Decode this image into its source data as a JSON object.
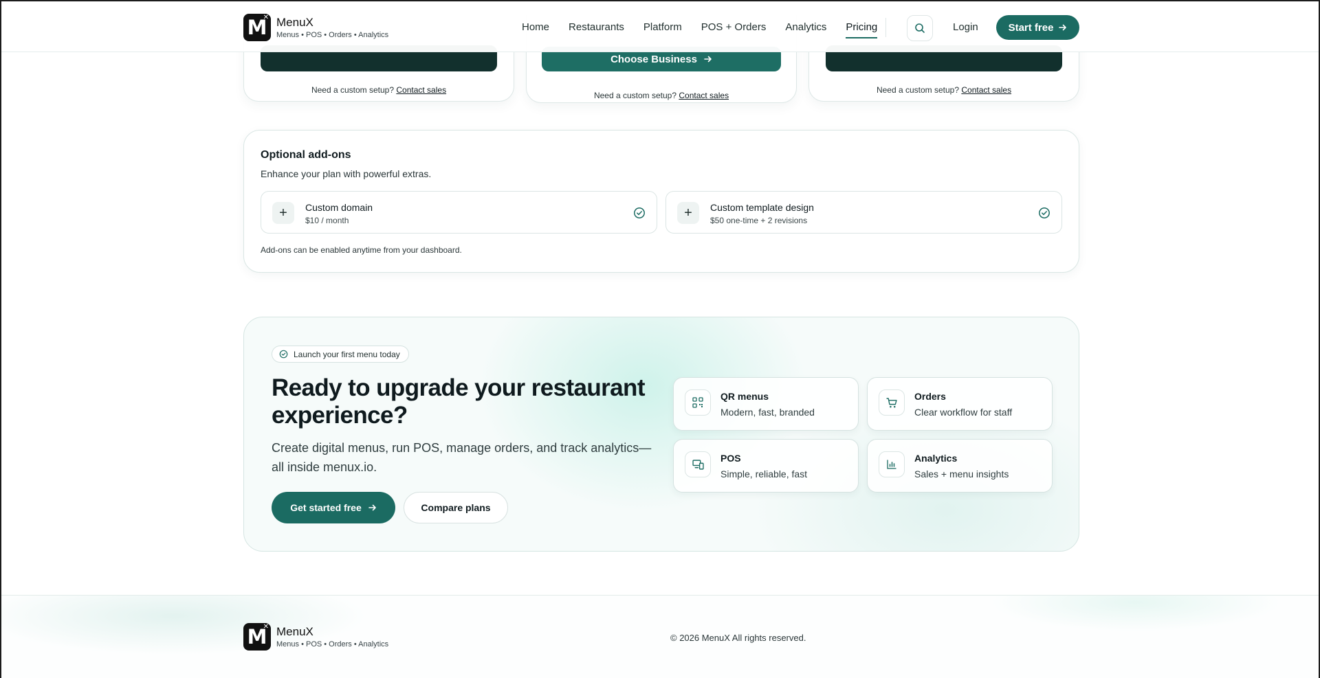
{
  "brand": {
    "name": "MenuX",
    "logo_letter": "M",
    "tagline": "Menus • POS • Orders • Analytics"
  },
  "nav": {
    "items": [
      "Home",
      "Restaurants",
      "Platform",
      "POS + Orders",
      "Analytics",
      "Pricing"
    ],
    "active": "Pricing",
    "login": "Login",
    "start": "Start free"
  },
  "pricing": {
    "middle_button": "Choose Business",
    "custom_text": "Need a custom setup?",
    "contact_link": "Contact sales"
  },
  "addons": {
    "title": "Optional add-ons",
    "subtitle": "Enhance your plan with powerful extras.",
    "items": [
      {
        "name": "Custom domain",
        "price": "$10 / month"
      },
      {
        "name": "Custom template design",
        "price": "$50 one-time + 2 revisions"
      }
    ],
    "note": "Add-ons can be enabled anytime from your dashboard."
  },
  "cta": {
    "pill": "Launch your first menu today",
    "headline": "Ready to upgrade your restaurant experience?",
    "lead": "Create digital menus, run POS, manage orders, and track analytics—all inside menux.io.",
    "primary": "Get started free",
    "secondary": "Compare plans",
    "features": [
      {
        "title": "QR menus",
        "desc": "Modern, fast, branded",
        "icon": "qr-code-icon"
      },
      {
        "title": "Orders",
        "desc": "Clear workflow for staff",
        "icon": "cart-icon"
      },
      {
        "title": "POS",
        "desc": "Simple, reliable, fast",
        "icon": "devices-icon"
      },
      {
        "title": "Analytics",
        "desc": "Sales + menu insights",
        "icon": "bar-chart-icon"
      }
    ]
  },
  "footer": {
    "copyright": "© 2026 MenuX All rights reserved."
  },
  "colors": {
    "accent": "#1b6b62",
    "dark_button": "#12302d",
    "text": "#0f1a1e"
  }
}
